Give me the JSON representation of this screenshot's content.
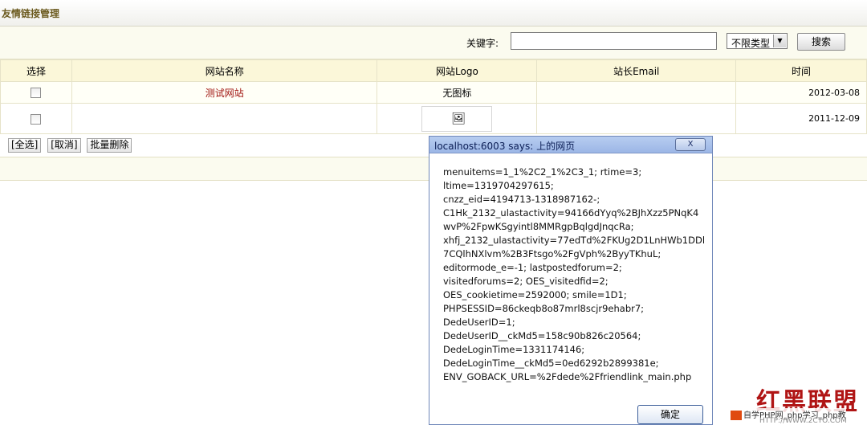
{
  "page": {
    "title": "友情链接管理"
  },
  "search": {
    "keyword_label": "关键字:",
    "keyword_value": "",
    "type_selected": "不限类型",
    "search_button": "搜索"
  },
  "table": {
    "headers": [
      "选择",
      "网站名称",
      "网站Logo",
      "站长Email",
      "时间"
    ],
    "rows": [
      {
        "name": "测试网站",
        "logo": "无图标",
        "email": "",
        "time": "2012-03-08"
      },
      {
        "name": "",
        "logo": "",
        "email": "",
        "time": "2011-12-09"
      }
    ]
  },
  "actions": {
    "select_all": "[全选]",
    "cancel": "[取消]",
    "batch_delete": "批量删除"
  },
  "dialog": {
    "title": "localhost:6003 says: 上的网页",
    "close_label": "X",
    "lines": [
      "menuitems=1_1%2C2_1%2C3_1; rtime=3;",
      "ltime=1319704297615;",
      "cnzz_eid=4194713-1318987162-;",
      "C1Hk_2132_ulastactivity=94166dYyq%2BJhXzz5PNqK4",
      "wvP%2FpwKSgyintl8MMRgpBqlgdJnqcRa;",
      "xhfj_2132_ulastactivity=77edTd%2FKUg2D1LnHWb1DDl",
      "7CQlhNXlvm%2B3Ftsgo%2FgVph%2ByyTKhuL;",
      "editormode_e=-1; lastpostedforum=2;",
      "visitedforums=2; OES_visitedfid=2;",
      "OES_cookietime=2592000; smile=1D1;",
      "PHPSESSID=86ckeqb8o87mrl8scjr9ehabr7;",
      "DedeUserID=1;",
      "DedeUserID__ckMd5=158c90b826c20564;",
      "DedeLoginTime=1331174146;",
      "DedeLoginTime__ckMd5=0ed6292b2899381e;",
      "ENV_GOBACK_URL=%2Fdede%2Ffriendlink_main.php"
    ],
    "ok_label": "确定"
  },
  "watermark": {
    "big": "红黑联盟",
    "line1": "自学PHP网_php学习_php教",
    "line2": "HTTP://WWW.2CTO.COM"
  },
  "colors": {
    "header_bg": "#fbf7d9",
    "site_name": "#a0140f",
    "dialog_caption": "#9cb6e6"
  },
  "icons": {
    "broken_image": "broken-image-icon",
    "dropdown": "chevron-down-icon"
  }
}
